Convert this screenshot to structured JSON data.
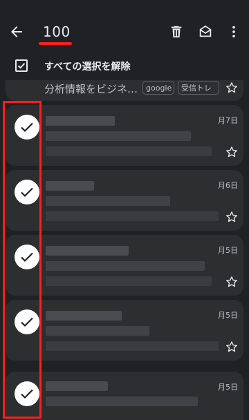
{
  "toolbar": {
    "selected_count": "100",
    "icons": [
      "back-arrow-icon",
      "trash-icon",
      "mark-read-icon",
      "more-vert-icon"
    ],
    "underline_color": "#ff1e1e"
  },
  "selection": {
    "label": "すべての選択を解除",
    "checked": true
  },
  "previous_item": {
    "snippet": "分析情報をビジネ…",
    "labels": [
      "google",
      "受信トレ"
    ]
  },
  "emails": [
    {
      "date": "月7日",
      "selected": true,
      "starred": false
    },
    {
      "date": "月6日",
      "selected": true,
      "starred": false
    },
    {
      "date": "月5日",
      "selected": true,
      "starred": false
    },
    {
      "date": "月5日",
      "selected": true,
      "starred": false
    },
    {
      "date": "月5日",
      "selected": true,
      "starred": false
    }
  ],
  "colors": {
    "background": "#202124",
    "card": "#2d2e30",
    "highlight": "#ff1e1e"
  }
}
